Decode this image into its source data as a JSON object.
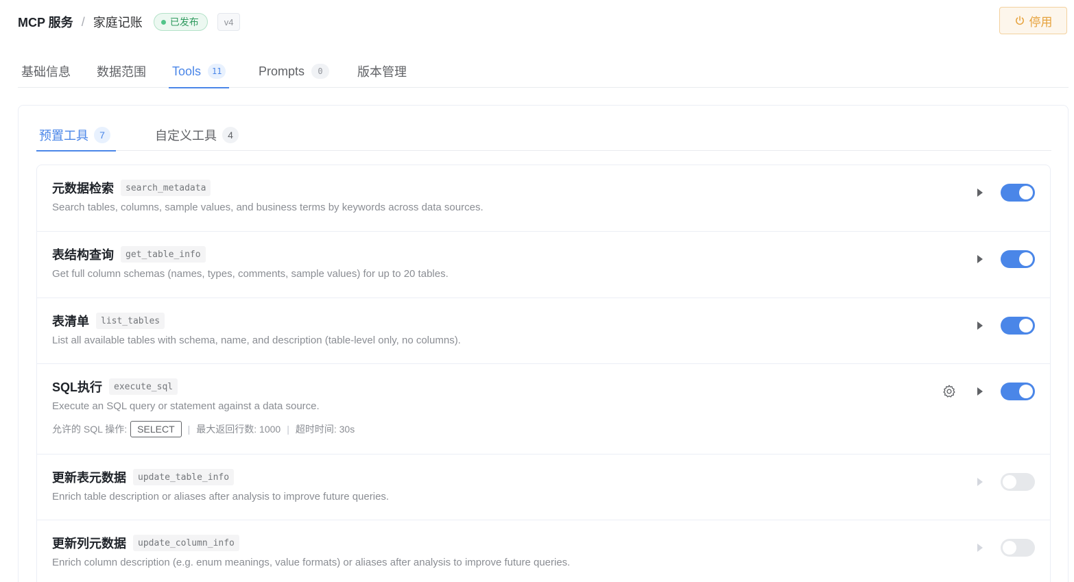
{
  "header": {
    "service_label": "MCP 服务",
    "separator": "/",
    "name": "家庭记账",
    "status": "已发布",
    "version": "v4",
    "disable_button": "停用"
  },
  "tabs": [
    {
      "label": "基础信息",
      "count": null,
      "active": false
    },
    {
      "label": "数据范围",
      "count": null,
      "active": false
    },
    {
      "label": "Tools",
      "count": "11",
      "active": true
    },
    {
      "label": "Prompts",
      "count": "0",
      "active": false
    },
    {
      "label": "版本管理",
      "count": null,
      "active": false
    }
  ],
  "subtabs": [
    {
      "label": "预置工具",
      "count": "7",
      "active": true
    },
    {
      "label": "自定义工具",
      "count": "4",
      "active": false
    }
  ],
  "tools": [
    {
      "name": "元数据检索",
      "code": "search_metadata",
      "description": "Search tables, columns, sample values, and business terms by keywords across data sources.",
      "enabled": true
    },
    {
      "name": "表结构查询",
      "code": "get_table_info",
      "description": "Get full column schemas (names, types, comments, sample values) for up to 20 tables.",
      "enabled": true
    },
    {
      "name": "表清单",
      "code": "list_tables",
      "description": "List all available tables with schema, name, and description (table-level only, no columns).",
      "enabled": true
    },
    {
      "name": "SQL执行",
      "code": "execute_sql",
      "description": "Execute an SQL query or statement against a data source.",
      "enabled": true,
      "meta": {
        "ops_label": "允许的 SQL 操作:",
        "op": "SELECT",
        "sep": "|",
        "max_rows": "最大返回行数: 1000",
        "timeout": "超时时间: 30s"
      }
    },
    {
      "name": "更新表元数据",
      "code": "update_table_info",
      "description": "Enrich table description or aliases after analysis to improve future queries.",
      "enabled": false
    },
    {
      "name": "更新列元数据",
      "code": "update_column_info",
      "description": "Enrich column description (e.g. enum meanings, value formats) or aliases after analysis to improve future queries.",
      "enabled": false
    }
  ],
  "colors": {
    "primary": "#4a86e8",
    "success": "#2f9a5e",
    "warning": "#e6a23c",
    "toggle_off": "#e6e8eb"
  },
  "icons": {
    "disable": "power-icon",
    "settings": "gear-icon",
    "expand": "caret-right-icon"
  }
}
